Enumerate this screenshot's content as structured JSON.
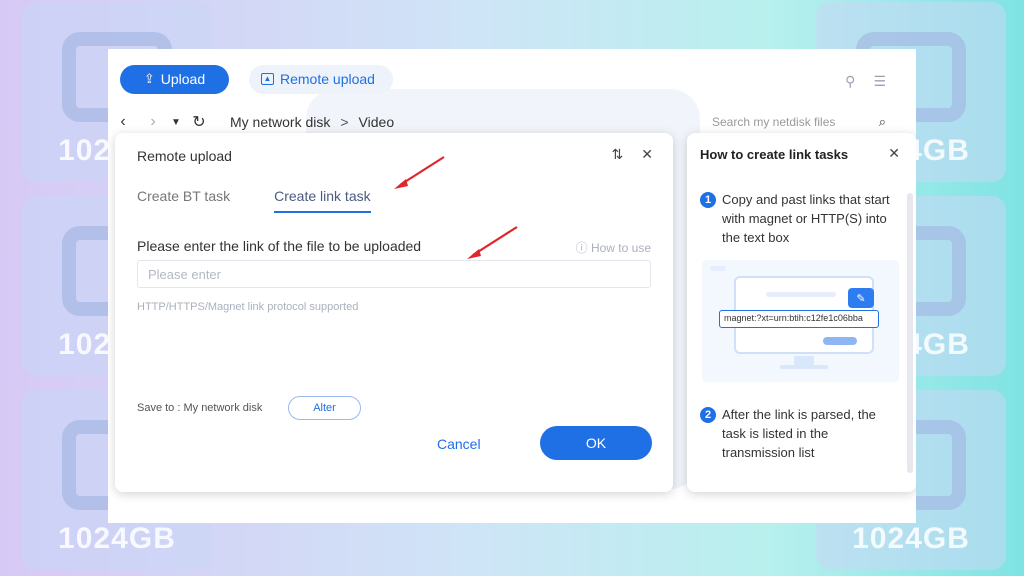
{
  "background": {
    "tile_text": "1024GB"
  },
  "toolbar": {
    "upload_label": "Upload",
    "remote_upload_label": "Remote upload"
  },
  "navigation": {
    "breadcrumb": [
      "My network disk",
      "Video"
    ],
    "breadcrumb_separator": ">",
    "search_placeholder": "Search my netdisk files"
  },
  "dialog": {
    "title": "Remote upload",
    "tabs": [
      {
        "label": "Create BT task",
        "active": false
      },
      {
        "label": "Create link task",
        "active": true
      }
    ],
    "field_label": "Please enter the link of the file to be uploaded",
    "how_to_use": "How to use",
    "input_placeholder": "Please enter",
    "input_value": "",
    "hint": "HTTP/HTTPS/Magnet link protocol supported",
    "save_to": "Save to : My network disk",
    "alter_label": "Alter",
    "cancel_label": "Cancel",
    "ok_label": "OK"
  },
  "help_panel": {
    "title": "How to create link tasks",
    "steps": [
      {
        "number": "1",
        "text": "Copy and past links that start with magnet or HTTP(S) into the text box"
      },
      {
        "number": "2",
        "text": "After the link is parsed, the task is listed in the transmission list"
      }
    ],
    "illustration_link": "magnet:?xt=urn:btih:c12fe1c06bba"
  },
  "colors": {
    "primary": "#1f6fe5",
    "annotation_arrow": "#e0252b"
  },
  "icons": {
    "upload": "upload-icon",
    "remote_upload": "remote-upload-icon",
    "back": "chevron-left-icon",
    "forward": "chevron-right-icon",
    "refresh": "refresh-icon",
    "search": "search-icon",
    "sort": "sort-icon",
    "close": "close-icon",
    "help": "question-circle-icon"
  }
}
